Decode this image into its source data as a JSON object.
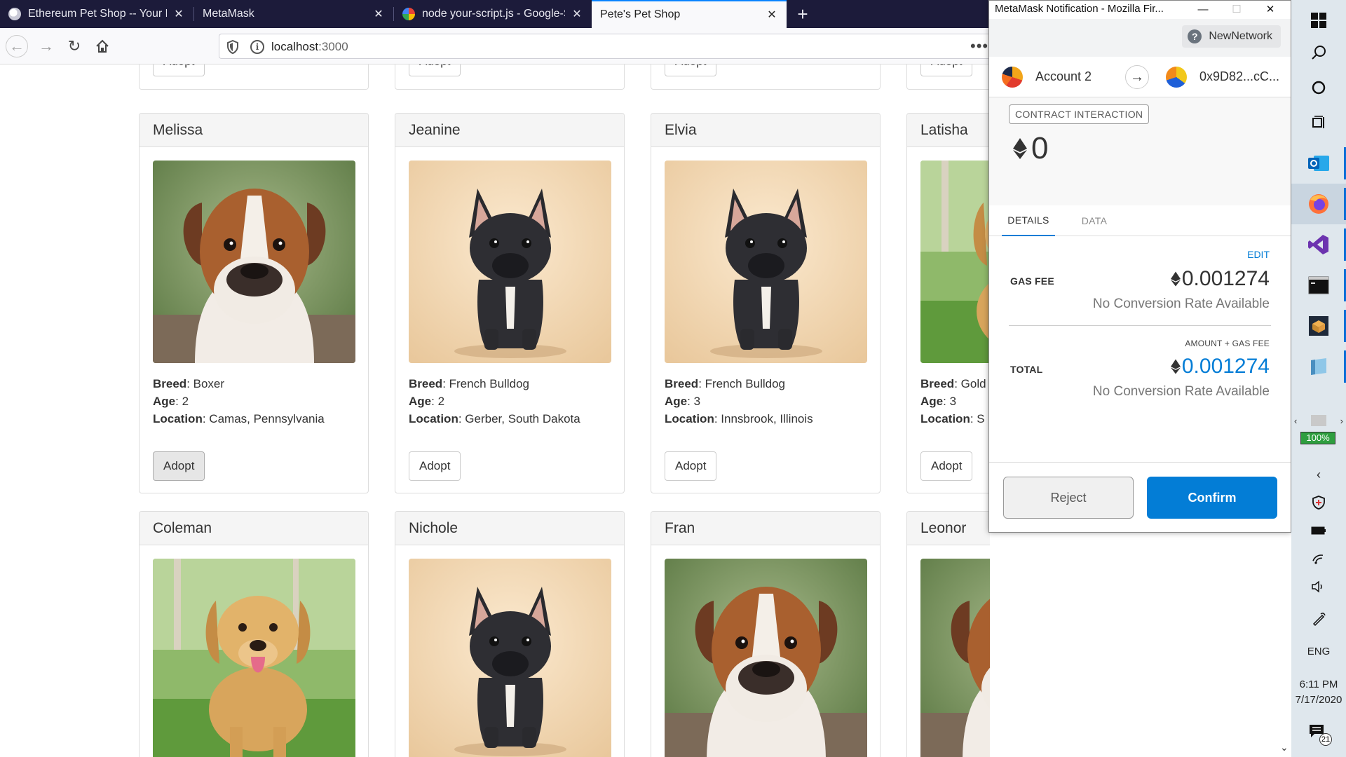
{
  "browser": {
    "tabs": [
      {
        "label": "Ethereum Pet Shop -- Your First",
        "active": false
      },
      {
        "label": "MetaMask",
        "active": false
      },
      {
        "label": "node your-script.js - Google-Sı",
        "active": false
      },
      {
        "label": "Pete's Pet Shop",
        "active": true
      }
    ],
    "url_host": "localhost",
    "url_port": ":3000",
    "new_tab_label": "+",
    "page_menu_label": "•••"
  },
  "pets": [
    {
      "name": "Melissa",
      "breed": "Boxer",
      "age": "2",
      "location": "Camas, Pennsylvania",
      "image": "boxer"
    },
    {
      "name": "Jeanine",
      "breed": "French Bulldog",
      "age": "2",
      "location": "Gerber, South Dakota",
      "image": "frenchie"
    },
    {
      "name": "Elvia",
      "breed": "French Bulldog",
      "age": "3",
      "location": "Innsbrook, Illinois",
      "image": "frenchie"
    },
    {
      "name": "Latisha",
      "breed": "Gold",
      "age": "3",
      "location": "S",
      "image": "golden"
    },
    {
      "name": "Coleman",
      "image": "golden"
    },
    {
      "name": "Nichole",
      "image": "frenchie"
    },
    {
      "name": "Fran",
      "image": "boxer"
    },
    {
      "name": "Leonor",
      "image": "boxer"
    }
  ],
  "labels": {
    "breed": "Breed",
    "age": "Age",
    "location": "Location",
    "adopt": "Adopt"
  },
  "metamask": {
    "window_title": "MetaMask Notification - Mozilla Fir...",
    "network": "NewNetwork",
    "from_account": "Account 2",
    "to_address": "0x9D82...cC...",
    "badge": "CONTRACT INTERACTION",
    "amount": "0",
    "tabs": {
      "details": "DETAILS",
      "data": "DATA"
    },
    "edit": "EDIT",
    "gas_fee_label": "GAS FEE",
    "gas_fee_value": "0.001274",
    "no_conversion": "No Conversion Rate Available",
    "amount_gas_label": "AMOUNT + GAS FEE",
    "total_label": "TOTAL",
    "total_value": "0.001274",
    "reject": "Reject",
    "confirm": "Confirm",
    "colors": {
      "accent": "#037dd6"
    }
  },
  "taskbar": {
    "battery": "100%",
    "language": "ENG",
    "time": "6:11 PM",
    "date": "7/17/2020",
    "notifications": "21"
  }
}
